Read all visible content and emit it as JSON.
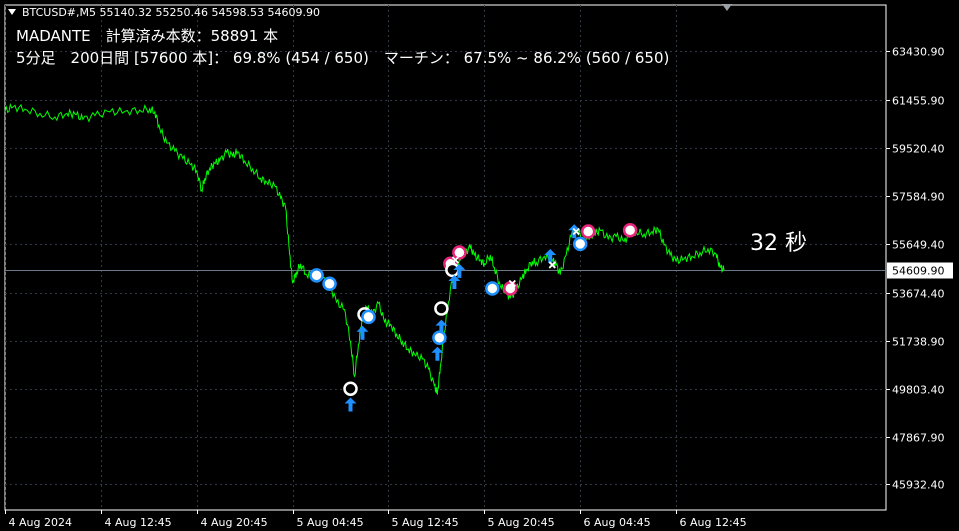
{
  "header": {
    "symbol": "BTCUSD#,M5",
    "ohlc": "55140.32 55250.46 54598.53 54609.90",
    "info_line_1": "MADANTE　計算済み本数：58891 本",
    "info_line_2": "5分足　200日間 [57600 本]：  69.8% (454 / 650)　マーチン：  67.5% ~ 86.2% (560 / 650)",
    "timer": "32 秒"
  },
  "colors": {
    "background": "#000000",
    "price_line": "#00ff00",
    "grid": "#303845",
    "axis_text": "#ffffff",
    "current_price_line": "#6a7a8a",
    "circle_blue": "#1e90ff",
    "circle_pink": "#e8237a",
    "arrow_blue": "#1e90ff",
    "cross_white": "#ffffff"
  },
  "chart_data": {
    "type": "line",
    "title": "",
    "xlabel": "",
    "ylabel": "",
    "ylim": [
      44900,
      65300
    ],
    "y_ticks": [
      "63430.90",
      "61455.90",
      "59520.40",
      "57584.90",
      "55649.40",
      "53674.40",
      "51738.90",
      "49803.40",
      "47867.90",
      "45932.40"
    ],
    "y_tick_values": [
      63430.9,
      61455.9,
      59520.4,
      57584.9,
      55649.4,
      53674.4,
      51738.9,
      49803.4,
      47867.9,
      45932.4
    ],
    "x_ticks": [
      "4 Aug 2024",
      "4 Aug 12:45",
      "4 Aug 20:45",
      "5 Aug 04:45",
      "5 Aug 12:45",
      "5 Aug 20:45",
      "6 Aug 04:45",
      "6 Aug 12:45"
    ],
    "x_tick_values": [
      0,
      96,
      192,
      288,
      384,
      480,
      576,
      672
    ],
    "x_range": [
      0,
      720
    ],
    "current_price": 54609.9,
    "current_price_label": "54609.90",
    "grid": true,
    "series": [
      {
        "points": [
          [
            0,
            61000
          ],
          [
            8,
            61180
          ],
          [
            20,
            61100
          ],
          [
            35,
            60920
          ],
          [
            50,
            60780
          ],
          [
            62,
            60920
          ],
          [
            70,
            60900
          ],
          [
            78,
            60680
          ],
          [
            90,
            60830
          ],
          [
            105,
            60980
          ],
          [
            120,
            61000
          ],
          [
            135,
            61060
          ],
          [
            145,
            61110
          ],
          [
            150,
            60990
          ],
          [
            155,
            60300
          ],
          [
            162,
            59720
          ],
          [
            170,
            59400
          ],
          [
            178,
            59100
          ],
          [
            186,
            58850
          ],
          [
            192,
            58600
          ],
          [
            197,
            57820
          ],
          [
            200,
            58300
          ],
          [
            205,
            58700
          ],
          [
            210,
            58900
          ],
          [
            215,
            59000
          ],
          [
            222,
            59350
          ],
          [
            228,
            59200
          ],
          [
            233,
            59370
          ],
          [
            240,
            59000
          ],
          [
            248,
            58680
          ],
          [
            256,
            58300
          ],
          [
            262,
            58150
          ],
          [
            270,
            58000
          ],
          [
            276,
            57500
          ],
          [
            281,
            57100
          ],
          [
            285,
            55250
          ],
          [
            288,
            54100
          ],
          [
            292,
            54500
          ],
          [
            296,
            54850
          ],
          [
            302,
            54400
          ],
          [
            310,
            54450
          ],
          [
            318,
            54250
          ],
          [
            325,
            54000
          ],
          [
            332,
            53300
          ],
          [
            340,
            53000
          ],
          [
            346,
            51700
          ],
          [
            350,
            50300
          ],
          [
            354,
            51600
          ],
          [
            358,
            52700
          ],
          [
            362,
            53100
          ],
          [
            368,
            52800
          ],
          [
            374,
            53250
          ],
          [
            380,
            52500
          ],
          [
            386,
            52400
          ],
          [
            392,
            52000
          ],
          [
            398,
            51700
          ],
          [
            404,
            51400
          ],
          [
            410,
            51200
          ],
          [
            418,
            51000
          ],
          [
            424,
            50600
          ],
          [
            430,
            49900
          ],
          [
            433,
            49600
          ],
          [
            436,
            50700
          ],
          [
            440,
            52100
          ],
          [
            444,
            53300
          ],
          [
            450,
            54700
          ],
          [
            456,
            55000
          ],
          [
            460,
            55300
          ],
          [
            466,
            55500
          ],
          [
            470,
            55200
          ],
          [
            476,
            55000
          ],
          [
            480,
            54850
          ],
          [
            486,
            55200
          ],
          [
            490,
            54700
          ],
          [
            496,
            53950
          ],
          [
            502,
            53700
          ],
          [
            506,
            53450
          ],
          [
            512,
            53800
          ],
          [
            518,
            54300
          ],
          [
            522,
            54600
          ],
          [
            528,
            54950
          ],
          [
            532,
            54900
          ],
          [
            540,
            55150
          ],
          [
            548,
            55000
          ],
          [
            552,
            54800
          ],
          [
            556,
            54400
          ],
          [
            562,
            55200
          ],
          [
            568,
            56150
          ],
          [
            572,
            56250
          ],
          [
            578,
            55900
          ],
          [
            584,
            55950
          ],
          [
            590,
            56050
          ],
          [
            596,
            56200
          ],
          [
            604,
            55850
          ],
          [
            612,
            55950
          ],
          [
            620,
            55750
          ],
          [
            626,
            56050
          ],
          [
            632,
            56150
          ],
          [
            640,
            56050
          ],
          [
            648,
            56150
          ],
          [
            654,
            56250
          ],
          [
            660,
            55600
          ],
          [
            666,
            55200
          ],
          [
            672,
            54950
          ],
          [
            680,
            55050
          ],
          [
            688,
            55150
          ],
          [
            696,
            55300
          ],
          [
            704,
            55450
          ],
          [
            712,
            55250
          ],
          [
            716,
            54700
          ],
          [
            720,
            54600
          ]
        ]
      }
    ],
    "markers": [
      {
        "type": "circle",
        "color": "blue",
        "x": 312,
        "y": 54380
      },
      {
        "type": "circle",
        "color": "blue",
        "x": 325,
        "y": 54040
      },
      {
        "type": "circle",
        "color": "white",
        "x": 360,
        "y": 52800
      },
      {
        "type": "circle",
        "color": "blue",
        "x": 364,
        "y": 52700
      },
      {
        "type": "arrow-up",
        "color": "blue",
        "x": 358,
        "y": 52100
      },
      {
        "type": "circle",
        "color": "white",
        "x": 346,
        "y": 49800
      },
      {
        "type": "arrow-up",
        "color": "blue",
        "x": 346,
        "y": 49200
      },
      {
        "type": "circle",
        "color": "white",
        "x": 437,
        "y": 53040
      },
      {
        "type": "arrow-up",
        "color": "blue",
        "x": 437,
        "y": 52350
      },
      {
        "type": "circle",
        "color": "blue",
        "x": 435,
        "y": 51860
      },
      {
        "type": "arrow-up",
        "color": "blue",
        "x": 433,
        "y": 51250
      },
      {
        "type": "circle",
        "color": "pink",
        "x": 446,
        "y": 54850
      },
      {
        "type": "circle",
        "color": "white",
        "x": 448,
        "y": 54600
      },
      {
        "type": "arrow-up",
        "color": "blue",
        "x": 450,
        "y": 54150
      },
      {
        "type": "circle",
        "color": "pink",
        "x": 455,
        "y": 55300
      },
      {
        "type": "cross",
        "color": "white",
        "x": 451,
        "y": 55000
      },
      {
        "type": "arrow-up",
        "color": "blue",
        "x": 455,
        "y": 54600
      },
      {
        "type": "circle",
        "color": "blue",
        "x": 488,
        "y": 53850
      },
      {
        "type": "circle",
        "color": "pink",
        "x": 506,
        "y": 53850
      },
      {
        "type": "cross",
        "color": "white",
        "x": 508,
        "y": 54050
      },
      {
        "type": "arrow-up",
        "color": "blue",
        "x": 546,
        "y": 55200
      },
      {
        "type": "cross",
        "color": "white",
        "x": 548,
        "y": 54800
      },
      {
        "type": "arrow-up",
        "color": "blue",
        "x": 570,
        "y": 56200
      },
      {
        "type": "cross",
        "color": "white",
        "x": 572,
        "y": 56150
      },
      {
        "type": "circle",
        "color": "blue",
        "x": 576,
        "y": 55650
      },
      {
        "type": "circle",
        "color": "pink",
        "x": 584,
        "y": 56150
      },
      {
        "type": "circle",
        "color": "pink",
        "x": 626,
        "y": 56200
      }
    ]
  }
}
